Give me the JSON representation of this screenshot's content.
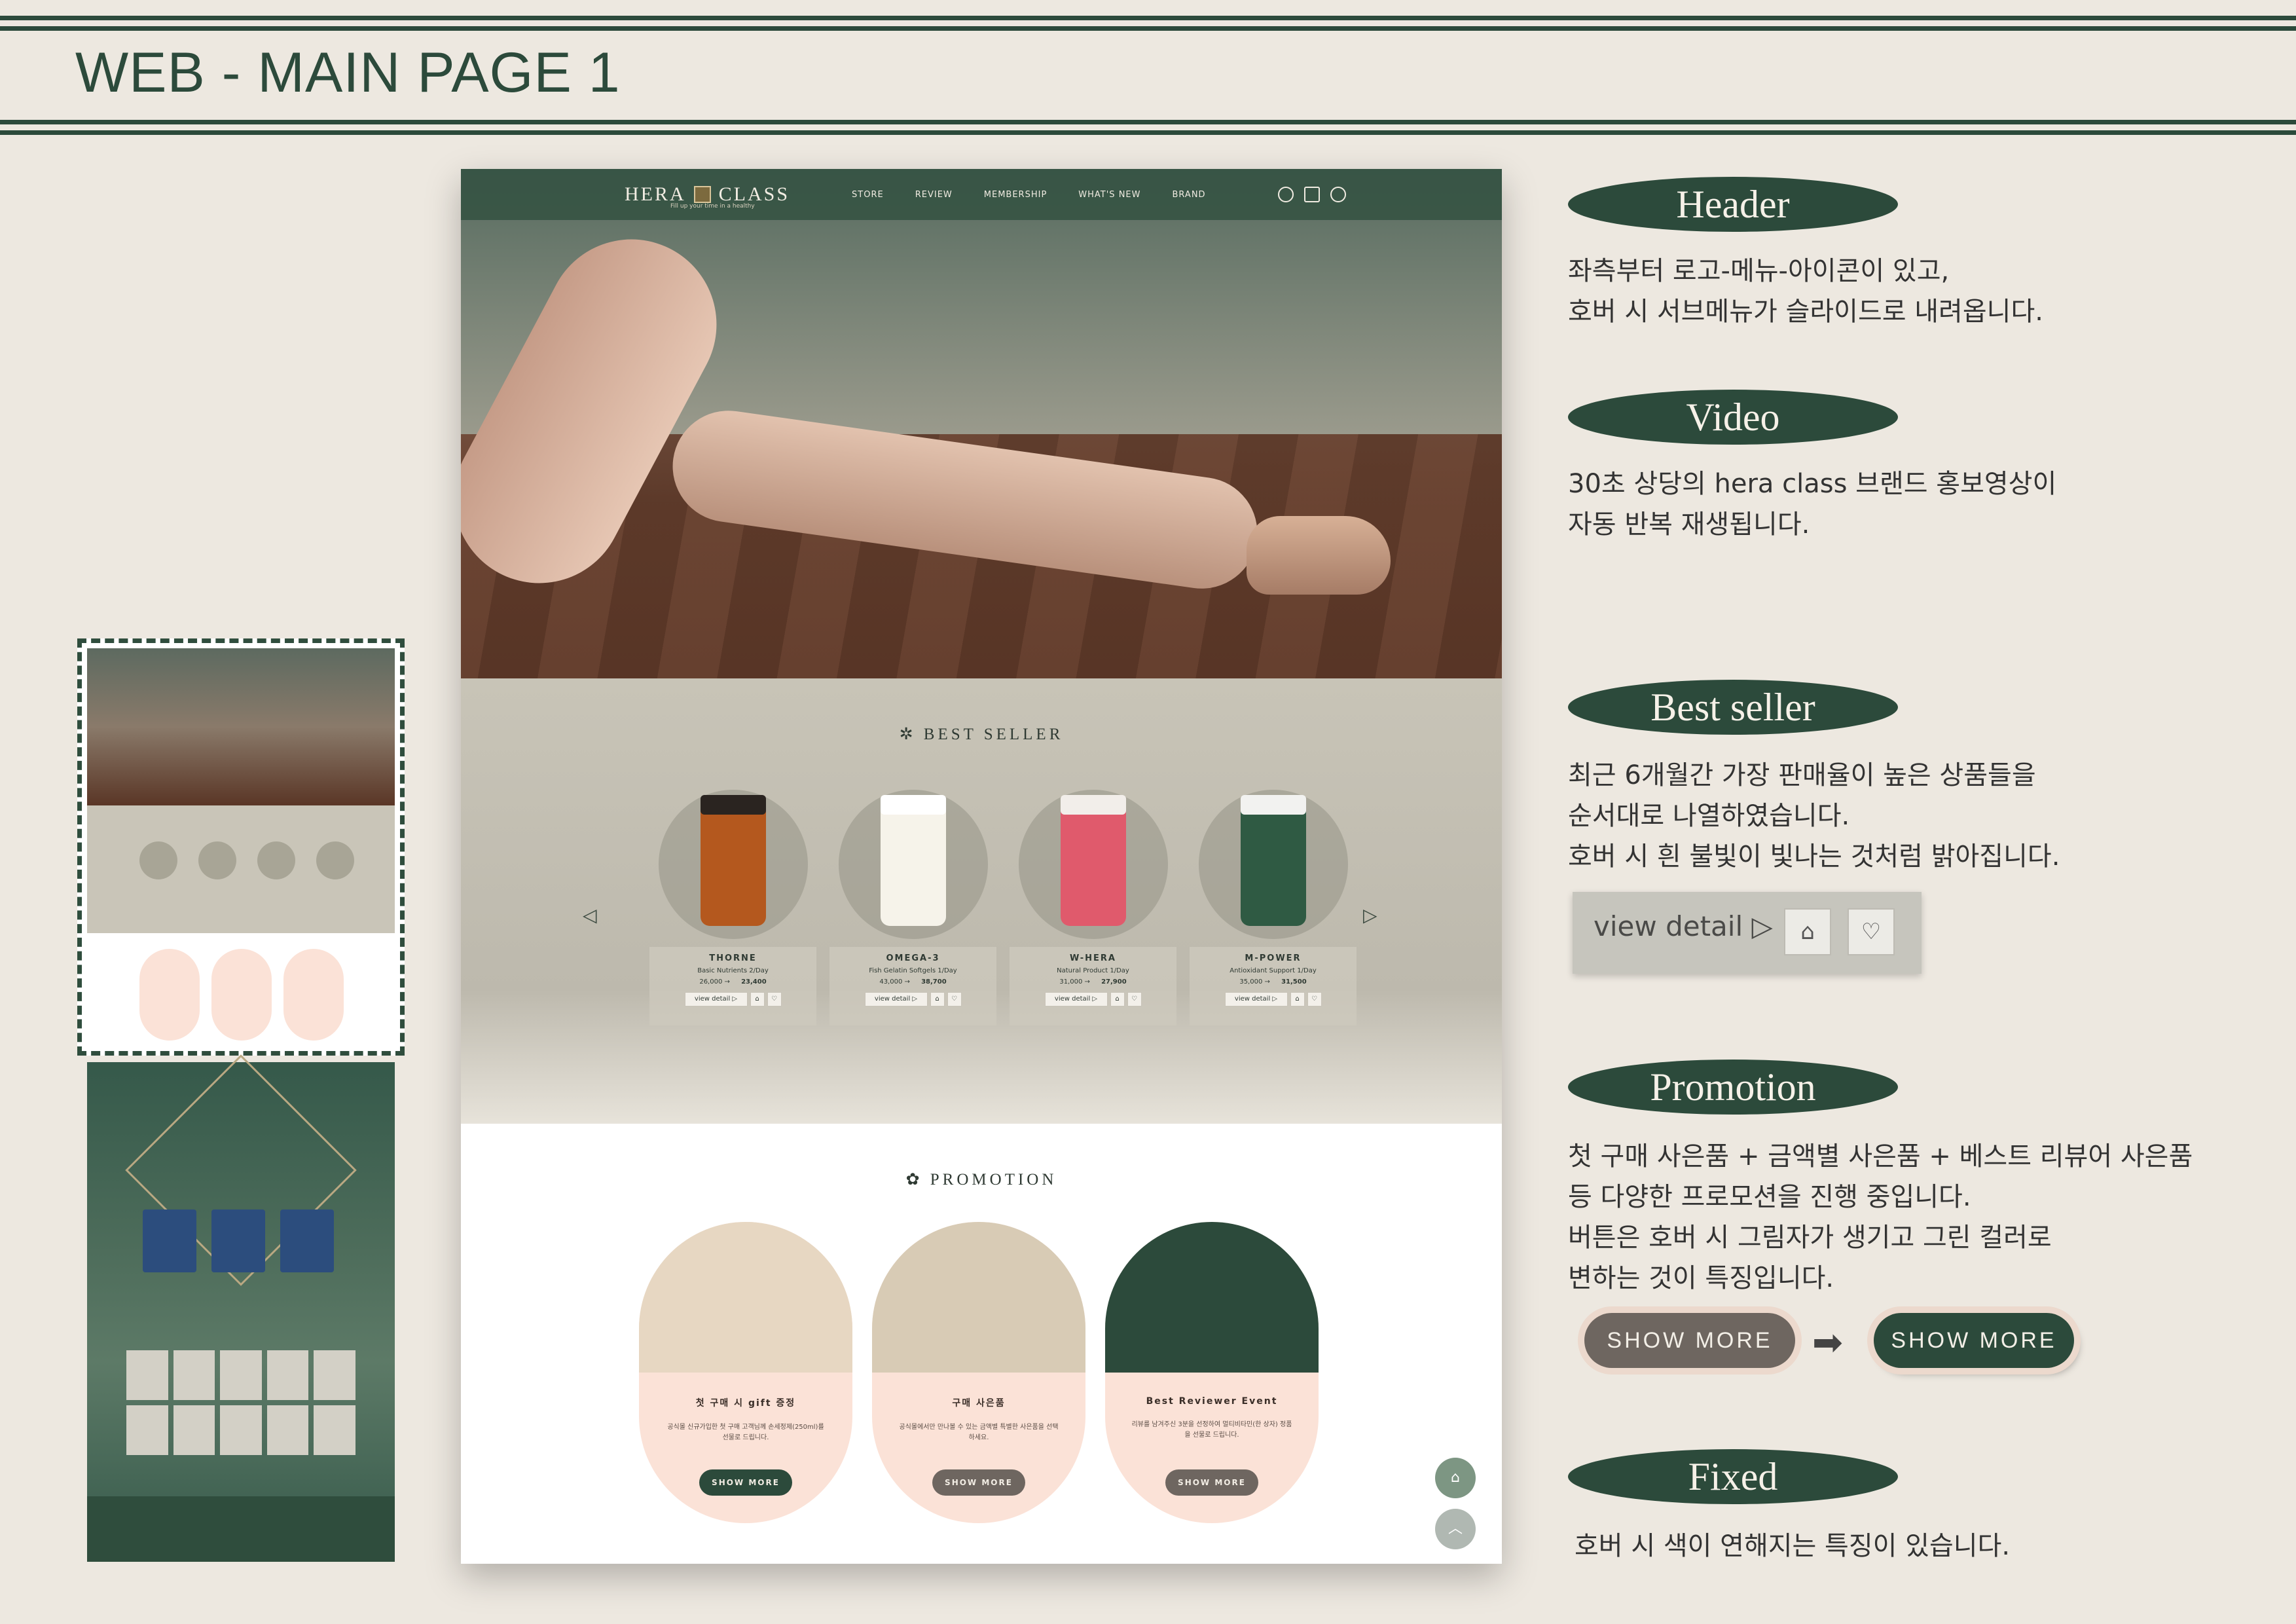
{
  "page_title": "WEB - MAIN PAGE 1",
  "site": {
    "logo_left": "HERA",
    "logo_right": "CLASS",
    "logo_tagline": "Fill up your time in a healthy",
    "nav": [
      "STORE",
      "REVIEW",
      "MEMBERSHIP",
      "WHAT'S NEW",
      "BRAND"
    ]
  },
  "best_seller": {
    "title": "BEST SELLER",
    "products": [
      {
        "name": "THORNE",
        "desc": "Basic Nutrients 2/Day",
        "price": "26,000",
        "sale": "23,400",
        "color": "#b4581e",
        "cap": "#2a2420"
      },
      {
        "name": "OMEGA-3",
        "desc": "Fish Gelatin Softgels 1/Day",
        "price": "43,000",
        "sale": "38,700",
        "color": "#f6f3ea",
        "cap": "#ffffff"
      },
      {
        "name": "W-HERA",
        "desc": "Natural Product 1/Day",
        "price": "31,000",
        "sale": "27,900",
        "color": "#e05a6c",
        "cap": "#f2eeea"
      },
      {
        "name": "M-POWER",
        "desc": "Antioxidant Support 1/Day",
        "price": "35,000",
        "sale": "31,500",
        "color": "#2f5a43",
        "cap": "#f2f2f0"
      }
    ],
    "view_detail": "view detail ▷"
  },
  "promotion": {
    "title": "PROMOTION",
    "cards": [
      {
        "title": "첫 구매 시 gift 증정",
        "desc": "공식몰 신규가입한 첫 구매 고객님께 손세정제(250ml)를 선물로 드립니다.",
        "button": "SHOW MORE",
        "btn_color": "#2c4a3b",
        "img": "#e7d7c2"
      },
      {
        "title": "구매 사은품",
        "desc": "공식몰에서만 만나볼 수 있는 금액별 특별한 사은품을 선택하세요.",
        "button": "SHOW MORE",
        "btn_color": "#6e6660",
        "img": "#d8cbb5"
      },
      {
        "title": "Best Reviewer Event",
        "desc": "리뷰를 남겨주신 3분을 선정하여 멀티비타민(한 상자) 정품을 선물로 드립니다.",
        "button": "SHOW MORE",
        "btn_color": "#6e6660",
        "img": "#2c4a3b"
      }
    ]
  },
  "annotations": {
    "header": {
      "label": "Header",
      "text": "좌측부터 로고-메뉴-아이콘이 있고,\n호버 시 서브메뉴가 슬라이드로 내려옵니다."
    },
    "video": {
      "label": "Video",
      "text": "30초 상당의 hera class 브랜드 홍보영상이\n자동 반복 재생됩니다."
    },
    "best_seller": {
      "label": "Best seller",
      "text": "최근 6개월간 가장 판매율이 높은 상품들을\n순서대로 나열하였습니다.\n호버 시 흰 불빛이 빛나는 것처럼 밝아집니다.",
      "demo_btn": "view detail ▷"
    },
    "promotion": {
      "label": "Promotion",
      "text": "첫 구매 사은품 + 금액별 사은품 + 베스트 리뷰어 사은품\n등 다양한 프로모션을 진행 중입니다.\n버튼은 호버 시 그림자가 생기고 그린 컬러로\n변하는 것이 특징입니다.",
      "btn_before": "SHOW MORE",
      "btn_after": "SHOW MORE"
    },
    "fixed": {
      "label": "Fixed",
      "text": "호버 시 색이 연해지는 특징이 있습니다."
    }
  },
  "colors": {
    "brand_green": "#2c4a3b",
    "button_gray": "#6e6660",
    "promo_pink": "#fbe2d7"
  }
}
